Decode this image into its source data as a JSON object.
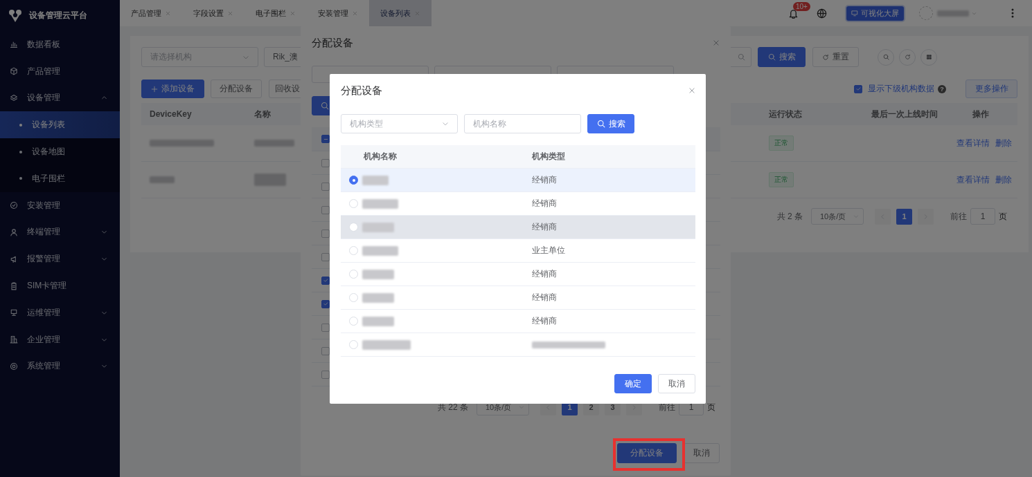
{
  "sidebar": {
    "title": "设备管理云平台",
    "items": [
      {
        "label": "数据看板",
        "selected": false
      },
      {
        "label": "产品管理",
        "selected": false
      },
      {
        "label": "设备管理",
        "selected": false,
        "expanded": true,
        "children": [
          {
            "label": "设备列表",
            "selected": true
          },
          {
            "label": "设备地图",
            "selected": false
          },
          {
            "label": "电子围栏",
            "selected": false
          }
        ]
      },
      {
        "label": "安装管理",
        "selected": false
      },
      {
        "label": "终端管理",
        "selected": false,
        "expanded": false
      },
      {
        "label": "报警管理",
        "selected": false,
        "expanded": false
      },
      {
        "label": "SIM卡管理",
        "selected": false
      },
      {
        "label": "运维管理",
        "selected": false,
        "expanded": false
      },
      {
        "label": "企业管理",
        "selected": false,
        "expanded": false
      },
      {
        "label": "系统管理",
        "selected": false,
        "expanded": false
      }
    ]
  },
  "tabs": [
    {
      "label": "产品管理",
      "selected": false
    },
    {
      "label": "字段设置",
      "selected": false
    },
    {
      "label": "电子围栏",
      "selected": false
    },
    {
      "label": "安装管理",
      "selected": false
    },
    {
      "label": "设备列表",
      "selected": true
    }
  ],
  "header": {
    "notification_badge": "10+",
    "big_screen_button": "可视化大屏"
  },
  "main": {
    "org_select": {
      "placeholder": "请选择机构"
    },
    "filter_field": {
      "value": "Rik_澳"
    },
    "search_button": "搜索",
    "reset_button": "重置",
    "add_button": "添加设备",
    "assign_button": "分配设备",
    "recall_button": "回收设",
    "show_sub_org": {
      "label": "显示下级机构数据",
      "checked": true
    },
    "help": "?",
    "more_button": "更多操作",
    "columns": [
      {
        "label": "DeviceKey"
      },
      {
        "label": "名称"
      },
      {
        "label": "运行状态"
      },
      {
        "label": "最后一次上线时间"
      },
      {
        "label": "操作"
      }
    ],
    "rows": [
      {
        "status": "正常",
        "actions": [
          "查看详情",
          "删除"
        ]
      },
      {
        "status": "正常",
        "actions": [
          "查看详情",
          "删除"
        ]
      }
    ],
    "pagination": {
      "total": "共 2 条",
      "page_size": "10条/页",
      "pages": [
        {
          "label": "1",
          "selected": true
        }
      ],
      "goto_label": "前往",
      "goto_value": "1",
      "goto_suffix": "页"
    }
  },
  "outer_dialog": {
    "title": "分配设备",
    "header_checkbox": {
      "indeterminate": true
    },
    "rows": [
      {
        "checked": false
      },
      {
        "checked": false
      },
      {
        "checked": false
      },
      {
        "checked": false
      },
      {
        "checked": false
      },
      {
        "checked": true
      },
      {
        "checked": true
      },
      {
        "checked": false
      },
      {
        "checked": false
      },
      {
        "checked": false
      }
    ],
    "pagination": {
      "total": "共 22 条",
      "page_size": "10条/页",
      "pages": [
        {
          "label": "1",
          "selected": true
        },
        {
          "label": "2",
          "selected": false
        },
        {
          "label": "3",
          "selected": false
        }
      ],
      "goto_label": "前往",
      "goto_value": "1",
      "goto_suffix": "页"
    },
    "buttons": [
      {
        "label": "分配设备",
        "kind": "primary",
        "highlighted": true
      },
      {
        "label": "取消",
        "kind": "default",
        "highlighted": false
      }
    ]
  },
  "inner_dialog": {
    "title": "分配设备",
    "type_select": {
      "placeholder": "机构类型"
    },
    "name_field": {
      "placeholder": "机构名称"
    },
    "search_button": "搜索",
    "columns": [
      {
        "label": "机构名称"
      },
      {
        "label": "机构类型"
      }
    ],
    "rows": [
      {
        "type": "经销商",
        "type_blurred": false,
        "selected": true,
        "hovered": false
      },
      {
        "type": "经销商",
        "type_blurred": false,
        "selected": false,
        "hovered": false
      },
      {
        "type": "经销商",
        "type_blurred": false,
        "selected": false,
        "hovered": true
      },
      {
        "type": "业主单位",
        "type_blurred": false,
        "selected": false,
        "hovered": false
      },
      {
        "type": "经销商",
        "type_blurred": false,
        "selected": false,
        "hovered": false
      },
      {
        "type": "经销商",
        "type_blurred": false,
        "selected": false,
        "hovered": false
      },
      {
        "type": "经销商",
        "type_blurred": false,
        "selected": false,
        "hovered": false
      },
      {
        "type_blurred": true,
        "selected": false,
        "hovered": false
      }
    ],
    "buttons": [
      {
        "label": "确定",
        "kind": "primary"
      },
      {
        "label": "取消",
        "kind": "default"
      }
    ]
  }
}
